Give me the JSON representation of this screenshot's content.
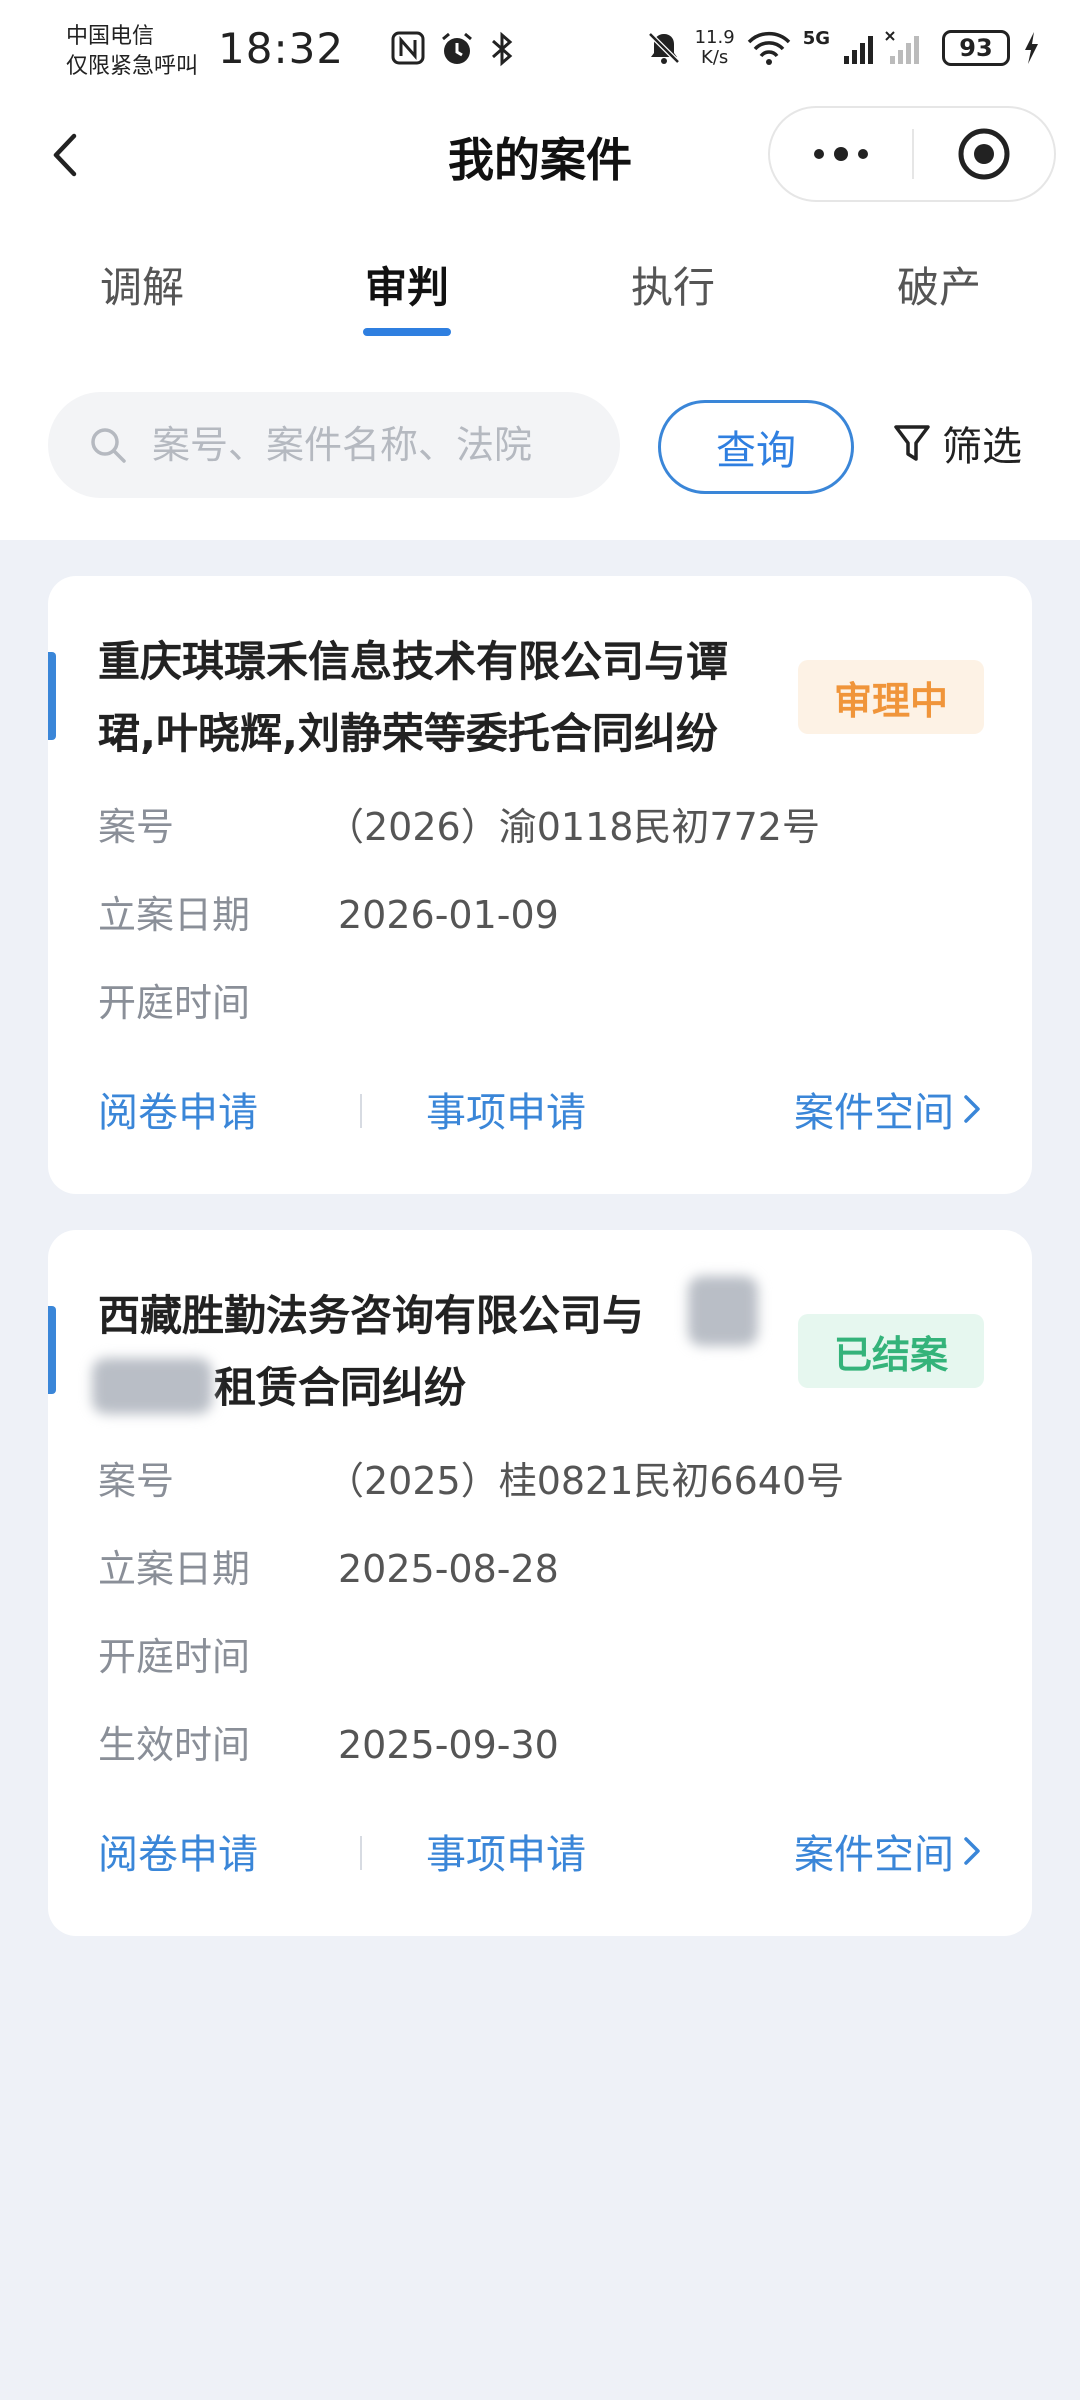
{
  "status_bar": {
    "carrier_line1": "中国电信",
    "carrier_line2": "仅限紧急呼叫",
    "time": "18:32",
    "net_speed_value": "11.9",
    "net_speed_unit": "K/s",
    "network": "5G",
    "battery": "93",
    "icons": [
      "nfc-icon",
      "alarm-icon",
      "bluetooth-icon",
      "mute-bell-icon",
      "wifi-icon",
      "signal-icon",
      "charging-icon"
    ]
  },
  "nav": {
    "title": "我的案件"
  },
  "tabs": [
    {
      "label": "调解",
      "active": false
    },
    {
      "label": "审判",
      "active": true
    },
    {
      "label": "执行",
      "active": false
    },
    {
      "label": "破产",
      "active": false
    }
  ],
  "search": {
    "placeholder": "案号、案件名称、法院",
    "query_label": "查询",
    "filter_label": "筛选"
  },
  "cards": [
    {
      "title": "重庆琪璟禾信息技术有限公司与谭珺,叶晓辉,刘静荣等委托合同纠纷",
      "status": "审理中",
      "rows": [
        {
          "label": "案号",
          "value": "（2026）渝0118民初772号"
        },
        {
          "label": "立案日期",
          "value": "2026-01-09"
        },
        {
          "label": "开庭时间",
          "value": ""
        }
      ],
      "actions": [
        "阅卷申请",
        "事项申请",
        "案件空间"
      ]
    },
    {
      "title_line1": "西藏胜勤法务咨询有限公司与",
      "title_line2": "租赁合同纠纷",
      "status": "已结案",
      "rows": [
        {
          "label": "案号",
          "value": "（2025）桂0821民初6640号"
        },
        {
          "label": "立案日期",
          "value": "2025-08-28"
        },
        {
          "label": "开庭时间",
          "value": ""
        },
        {
          "label": "生效时间",
          "value": "2025-09-30"
        }
      ],
      "actions": [
        "阅卷申请",
        "事项申请",
        "案件空间"
      ]
    }
  ],
  "colors": {
    "accent": "#2f7fe0",
    "status_in_progress": "#f0953a",
    "status_closed": "#34b37a",
    "page_bg": "#eef1f7"
  }
}
